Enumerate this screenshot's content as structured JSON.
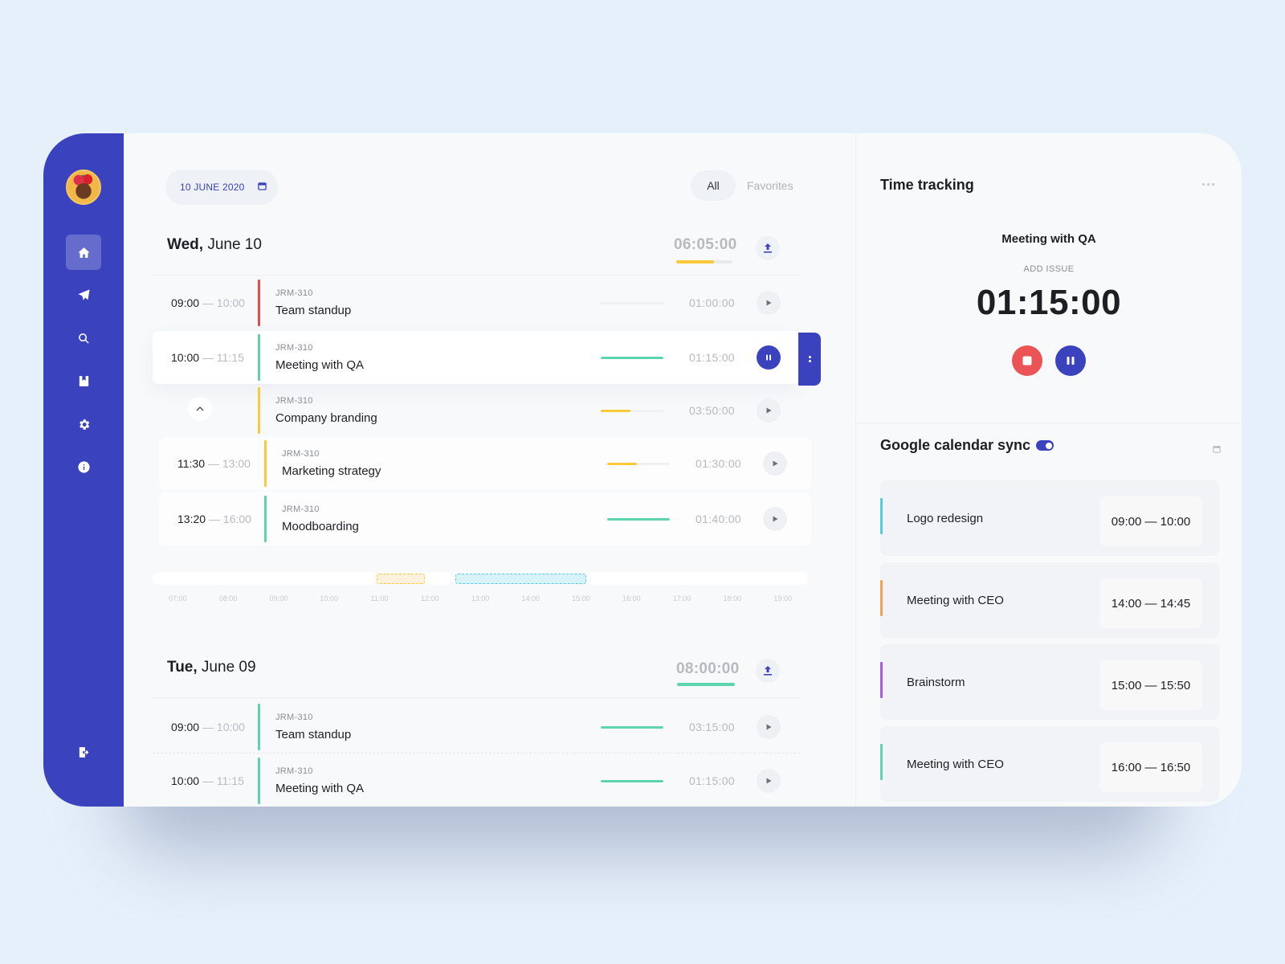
{
  "sidebar": {
    "avatar_alt": "User avatar",
    "items": [
      {
        "name": "home",
        "icon": "home-icon",
        "active": true
      },
      {
        "name": "send",
        "icon": "send-icon",
        "active": false
      },
      {
        "name": "search",
        "icon": "search-icon",
        "active": false
      },
      {
        "name": "bookmark",
        "icon": "bookmark-icon",
        "active": false
      },
      {
        "name": "settings",
        "icon": "gear-icon",
        "active": false
      },
      {
        "name": "info",
        "icon": "info-icon",
        "active": false
      }
    ],
    "logout_icon": "logout-icon"
  },
  "main": {
    "date_picker": {
      "label": "10 JUNE 2020",
      "icon": "calendar-icon"
    },
    "filters": {
      "all": "All",
      "favorites": "Favorites",
      "selected": "All"
    },
    "days": [
      {
        "day_bold": "Wed,",
        "day_rest": " June 10",
        "total": "06:05:00",
        "total_progress": 0.67,
        "progress_color": "#fcc93a",
        "entries": [
          {
            "start": "09:00",
            "end": "— 10:00",
            "code": "JRM-310",
            "title": "Team standup",
            "duration": "01:00:00",
            "progress": 0.0,
            "color": "#e74c4c",
            "state": "play"
          },
          {
            "start": "10:00",
            "end": "— 11:15",
            "code": "JRM-310",
            "title": "Meeting with QA",
            "duration": "01:15:00",
            "progress": 1.0,
            "color": "#5dd3ae",
            "state": "pause"
          },
          {
            "start": "",
            "end": "",
            "code": "JRM-310",
            "title": "Company branding",
            "duration": "03:50:00",
            "progress": 0.48,
            "color": "#fcc93a",
            "state": "play"
          },
          {
            "start": "11:30",
            "end": "— 13:00",
            "code": "JRM-310",
            "title": "Marketing strategy",
            "duration": "01:30:00",
            "progress": 0.48,
            "color": "#fcc93a",
            "state": "play"
          },
          {
            "start": "13:20",
            "end": "— 16:00",
            "code": "JRM-310",
            "title": "Moodboarding",
            "duration": "01:40:00",
            "progress": 1.0,
            "color": "#5dd3ae",
            "state": "play"
          }
        ]
      },
      {
        "day_bold": "Tue,",
        "day_rest": " June 09",
        "total": "08:00:00",
        "total_progress": 1.0,
        "progress_color": "#5dd3ae",
        "entries": [
          {
            "start": "09:00",
            "end": "— 10:00",
            "code": "JRM-310",
            "title": "Team standup",
            "duration": "03:15:00",
            "progress": 1.0,
            "color": "#5dd3ae",
            "state": "play"
          },
          {
            "start": "10:00",
            "end": "— 11:15",
            "code": "JRM-310",
            "title": "Meeting with QA",
            "duration": "01:15:00",
            "progress": 1.0,
            "color": "#5dd3ae",
            "state": "play"
          }
        ]
      }
    ],
    "timeline": {
      "ticks": [
        "07:00",
        "08:00",
        "09:00",
        "10:00",
        "11:00",
        "12:00",
        "13:00",
        "14:00",
        "15:00",
        "16:00",
        "17:00",
        "18:00",
        "19:00"
      ],
      "range_start_hour": 6.5,
      "range_end_hour": 19.5,
      "blocks": [
        {
          "start_hour": 10.95,
          "end_hour": 11.9,
          "color": "#fff1dc",
          "border": "#fcc93a"
        },
        {
          "start_hour": 12.5,
          "end_hour": 15.1,
          "color": "#d7f2f8",
          "border": "#56c9e5"
        }
      ]
    }
  },
  "time_tracking": {
    "title": "Time tracking",
    "more_icon": "more-icon",
    "current_task": "Meeting with QA",
    "add_issue": "ADD ISSUE",
    "timer": "01:15:00",
    "stop_icon": "stop-icon",
    "pause_icon": "pause-icon"
  },
  "google_sync": {
    "title": "Google calendar sync",
    "enabled": true,
    "events": [
      {
        "name": "Logo redesign",
        "range": "09:00 — 10:00",
        "color": "#56c9e5"
      },
      {
        "name": "Meeting with CEO",
        "range": "14:00 — 14:45",
        "color": "#f4a056"
      },
      {
        "name": "Brainstorm",
        "range": "15:00 — 15:50",
        "color": "#a05ce8"
      },
      {
        "name": "Meeting with CEO",
        "range": "16:00 — 16:50",
        "color": "#5dd3ae"
      }
    ]
  },
  "colors": {
    "primary": "#3a43bd",
    "danger": "#ea5455",
    "green": "#5dd3ae",
    "yellow": "#fcc93a"
  }
}
